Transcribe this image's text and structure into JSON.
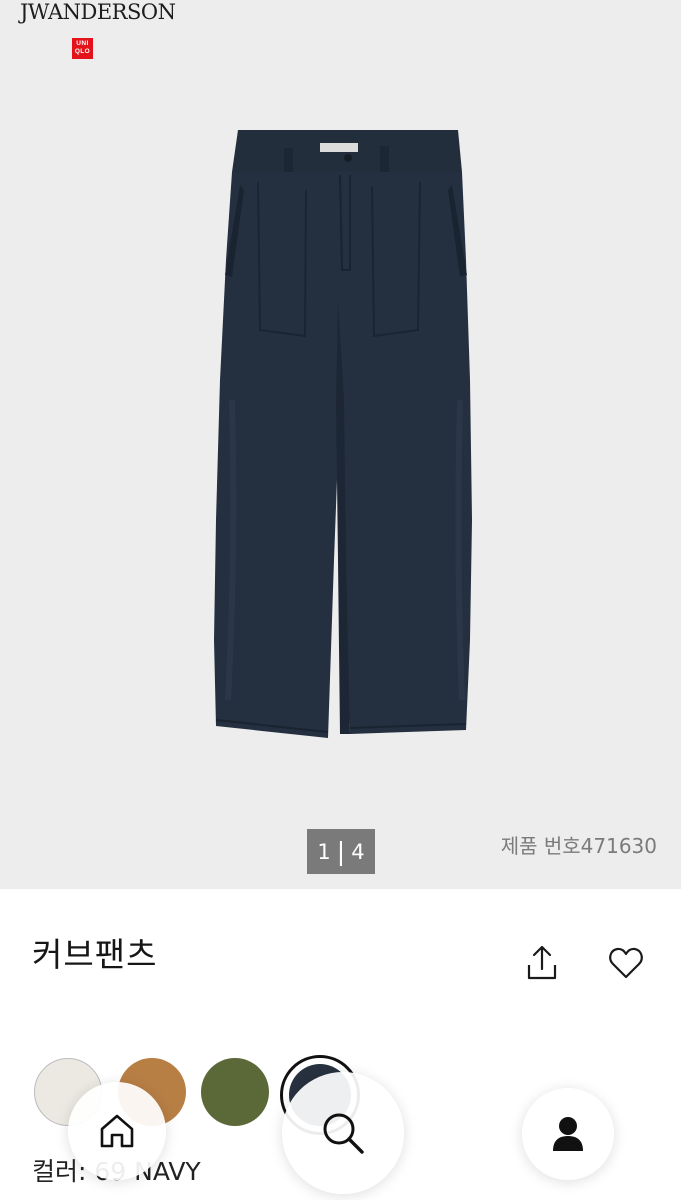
{
  "brand": {
    "collab_logo": "JWANDERSON",
    "store_logo": "UNI QLO"
  },
  "gallery": {
    "current_page": "1",
    "separator": "|",
    "total_pages": "4",
    "product_number": "제품 번호471630"
  },
  "product": {
    "title": "커브팬츠",
    "color_label": "컬러: 69 NAVY"
  },
  "actions": {
    "share_icon": "share-icon",
    "favorite_icon": "heart-icon"
  },
  "swatches": [
    {
      "name": "off-white",
      "color": "#ece9e2"
    },
    {
      "name": "brown",
      "color": "#b87f45"
    },
    {
      "name": "olive",
      "color": "#5b6837"
    },
    {
      "name": "navy",
      "color": "#27313f",
      "selected": true
    }
  ],
  "bottom_nav": {
    "home_icon": "home-icon",
    "search_icon": "search-icon",
    "account_icon": "person-icon"
  },
  "colors": {
    "hero_bg": "#ededed",
    "pants": "#243040",
    "uniqlo_red": "#e4131a",
    "pager_bg": "#7a7a7a"
  }
}
